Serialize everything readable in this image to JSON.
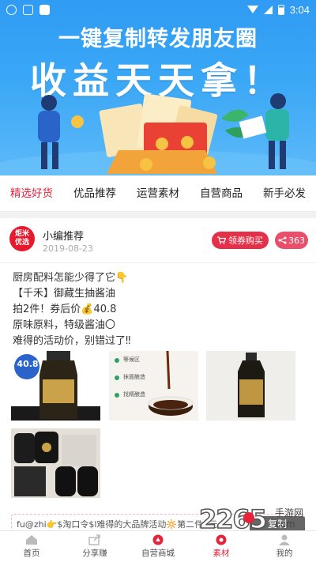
{
  "status_bar": {
    "time": "3:04"
  },
  "banner": {
    "line1": "一键复制转发朋友圈",
    "line2": "收益天天拿！"
  },
  "tabs": [
    {
      "label": "精选好货",
      "active": true
    },
    {
      "label": "优品推荐",
      "active": false
    },
    {
      "label": "运营素材",
      "active": false
    },
    {
      "label": "自营商品",
      "active": false
    },
    {
      "label": "新手必发",
      "active": false
    }
  ],
  "post": {
    "avatar_text_top": "炬米",
    "avatar_text_bottom": "优选",
    "author": "小编推荐",
    "date": "2019-08-23",
    "coupon_button": "领券购买",
    "share_count": "363",
    "lines": [
      "厨房配料怎能少得了它👇",
      "【千禾】御藏生抽酱油",
      "拍2件！券后价💰40.8",
      "原味原料，特级酱油〇",
      "难得的活动价，别错过了‼"
    ],
    "image1_price_badge": "40.8",
    "image2_steps": [
      "等候区",
      "抹面酿造",
      "找精酿造"
    ],
    "copy_text": "fu@zhi👉$淘口令$l难得的大品牌活动🔆第二件0元",
    "copy_button": "复制"
  },
  "bottom_nav": [
    {
      "label": "首页",
      "icon": "home-icon",
      "active": false
    },
    {
      "label": "分享赚",
      "icon": "share-icon",
      "active": false
    },
    {
      "label": "自营商城",
      "icon": "store-icon",
      "active": false
    },
    {
      "label": "素材",
      "icon": "material-icon",
      "active": true
    },
    {
      "label": "我的",
      "icon": "user-icon",
      "active": false
    }
  ],
  "watermark": {
    "number": "2265",
    "dot": ".",
    "sub1": "手游网",
    "sub2": "com"
  },
  "colors": {
    "accent": "#e5243b",
    "banner_blue": "#3aa7f6"
  }
}
